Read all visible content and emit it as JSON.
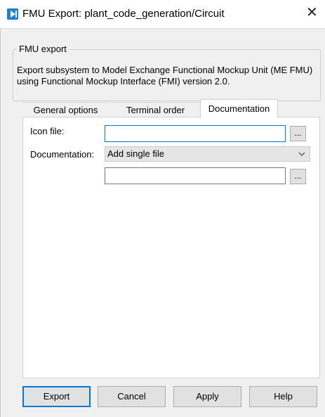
{
  "window": {
    "title": "FMU Export: plant_code_generation/Circuit",
    "close_symbol": "✕",
    "icon": "plecs-app-icon",
    "accent_color": "#0078d7"
  },
  "group": {
    "legend": "FMU export",
    "description": "Export subsystem to Model Exchange Functional Mockup Unit (ME FMU) using Functional Mockup Interface (FMI) version 2.0."
  },
  "tabs": [
    {
      "label": "General options",
      "selected": false
    },
    {
      "label": "Terminal order",
      "selected": false
    },
    {
      "label": "Documentation",
      "selected": true
    }
  ],
  "documentation_tab": {
    "icon_file_label": "Icon file:",
    "icon_file_value": "",
    "documentation_label": "Documentation:",
    "documentation_selected": "Add single file",
    "doc_file_value": "",
    "browse_label": "..."
  },
  "footer": {
    "export": "Export",
    "cancel": "Cancel",
    "apply": "Apply",
    "help": "Help"
  }
}
